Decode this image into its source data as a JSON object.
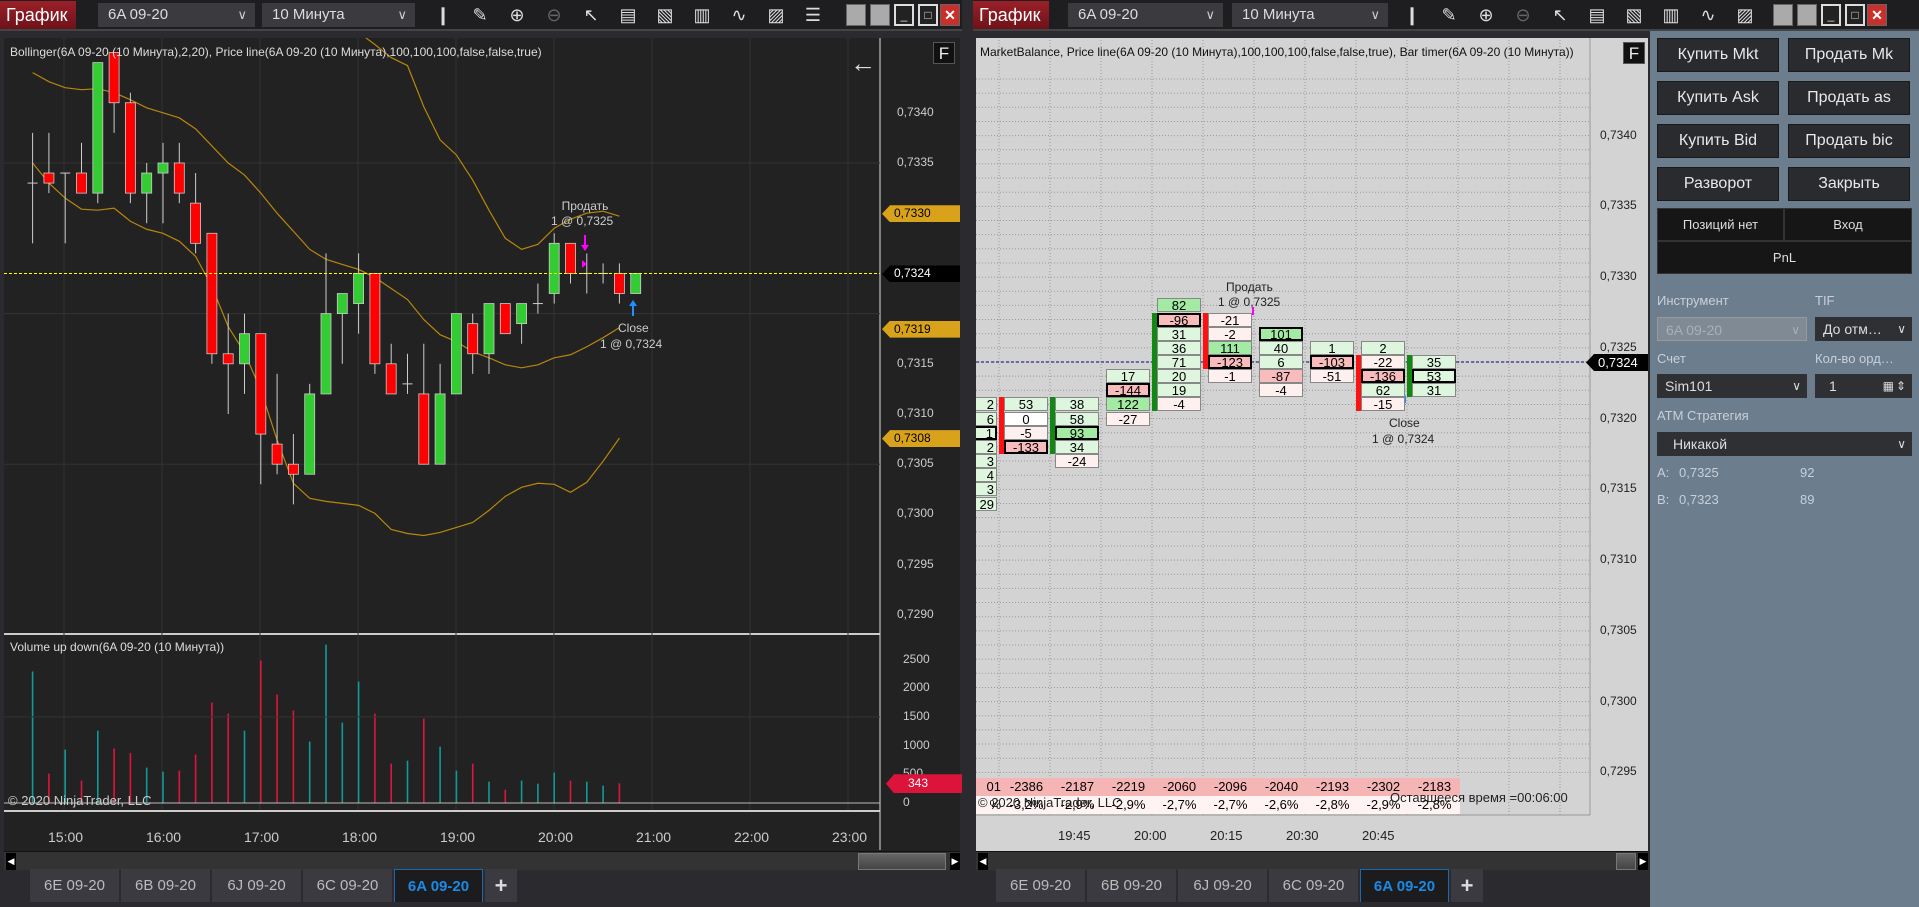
{
  "left_window": {
    "title": "График",
    "instrument": "6A 09-20",
    "interval": "10 Минута",
    "indicator_label": "Bollinger(6A 09-20 (10 Минута),2,20), Price line(6A 09-20 (10 Минута),100,100,100,false,false,true)",
    "volume_label": "Volume up down(6A 09-20 (10 Минута))",
    "copyright": "© 2020 NinjaTrader, LLC",
    "f_button": "F",
    "back_arrow": "←",
    "price_axis": [
      "0,7340",
      "0,7335",
      "0,7315",
      "0,7310",
      "0,7305",
      "0,7300",
      "0,7295",
      "0,7290"
    ],
    "price_axis_values": [
      0.734,
      0.7335,
      0.7315,
      0.731,
      0.7305,
      0.73,
      0.7295,
      0.729
    ],
    "tags": [
      {
        "text": "0,7330",
        "value": 0.733,
        "color": "#d9a21b",
        "fg": "#000"
      },
      {
        "text": "0,7324",
        "value": 0.7324,
        "color": "#000000",
        "fg": "#fff"
      },
      {
        "text": "0,7319",
        "value": 0.73185,
        "color": "#d9a21b",
        "fg": "#000"
      },
      {
        "text": "0,7308",
        "value": 0.73076,
        "color": "#d9a21b",
        "fg": "#000"
      }
    ],
    "volume_axis": [
      "2500",
      "2000",
      "1500",
      "1000",
      "500",
      "0"
    ],
    "volume_axis_values": [
      2500,
      2000,
      1500,
      1000,
      500,
      0
    ],
    "volume_tag": "343",
    "time_axis": [
      "15:00",
      "16:00",
      "17:00",
      "18:00",
      "19:00",
      "20:00",
      "21:00",
      "22:00",
      "23:00"
    ],
    "sell_marker": {
      "label": "Продать",
      "detail": "1 @ 0,7325"
    },
    "close_marker": {
      "label": "Close",
      "detail": "1 @ 0,7324"
    },
    "tabs": [
      "6E 09-20",
      "6B 09-20",
      "6J 09-20",
      "6C 09-20",
      "6A 09-20"
    ],
    "active_tab": 4,
    "plus": "+"
  },
  "right_window": {
    "title": "График",
    "instrument": "6A 09-20",
    "interval": "10 Минута",
    "indicator_label": "MarketBalance, Price line(6A 09-20 (10 Минута),100,100,100,false,false,true), Bar timer(6A 09-20 (10 Минута))",
    "f_button": "F",
    "copyright": "© 2020 NinjaTrader, LLC",
    "remaining_time": "Оставшееся время =00:06:00",
    "price_axis": [
      "0,7340",
      "0,7335",
      "0,7330",
      "0,7325",
      "0,7320",
      "0,7315",
      "0,7310",
      "0,7305",
      "0,7300",
      "0,7295"
    ],
    "price_axis_values": [
      0.734,
      0.7335,
      0.733,
      0.7325,
      0.732,
      0.7315,
      0.731,
      0.7305,
      0.73,
      0.7295
    ],
    "price_tag": "0,7324",
    "time_axis": [
      "19:45",
      "20:00",
      "20:15",
      "20:30",
      "20:45"
    ],
    "sell_marker": {
      "label": "Продать",
      "detail": "1 @ 0,7325"
    },
    "close_marker": {
      "label": "Close",
      "detail": "1 @ 0,7324"
    },
    "tabs": [
      "6E 09-20",
      "6B 09-20",
      "6J 09-20",
      "6C 09-20",
      "6A 09-20"
    ],
    "active_tab": 4,
    "plus": "+"
  },
  "toolbar_icons": [
    "candlestick-icon",
    "pencil-icon",
    "zoom-in-icon",
    "zoom-out-icon",
    "pointer-icon",
    "data-box-icon",
    "properties-icon",
    "bars-icon",
    "strategy-icon",
    "clipboard-icon",
    "list-icon"
  ],
  "order_panel": {
    "buttons": [
      "Купить Mkt",
      "Продать Mk",
      "Купить Ask",
      "Продать as",
      "Купить Bid",
      "Продать bic",
      "Разворот",
      "Закрыть"
    ],
    "position": "Позиций нет",
    "entry": "Вход",
    "pnl": "PnL",
    "instrument_label": "Инструмент",
    "instrument_value": "6A 09-20",
    "tif_label": "TIF",
    "tif_value": "До отм…",
    "account_label": "Счет",
    "account_value": "Sim101",
    "qty_label": "Кол-во орд…",
    "qty_value": "1",
    "atm_label": "АТМ Стратегия",
    "atm_value": "Никакой",
    "ask_label": "A:",
    "ask_price": "0,7325",
    "ask_size": "92",
    "bid_label": "B:",
    "bid_price": "0,7323",
    "bid_size": "89"
  },
  "colors": {
    "up": "#33cc33",
    "down": "#ff0000",
    "vol_up": "#0f9a9a",
    "vol_down": "#e0143c",
    "band": "#b8860b",
    "price_line": "#ffff00"
  },
  "chart_data": [
    {
      "type": "candlestick",
      "title": "6A 09-20 (10 Минута)",
      "start_time": "14:40",
      "interval_minutes": 10,
      "ohlc": [
        [
          0.7333,
          0.7338,
          0.7327,
          0.7333
        ],
        [
          0.7334,
          0.7338,
          0.7332,
          0.7333
        ],
        [
          0.7334,
          0.7334,
          0.7327,
          0.7334
        ],
        [
          0.7334,
          0.7337,
          0.7332,
          0.7332
        ],
        [
          0.7332,
          0.7345,
          0.7331,
          0.7345
        ],
        [
          0.7346,
          0.7346,
          0.7338,
          0.7341
        ],
        [
          0.7341,
          0.7342,
          0.7331,
          0.7332
        ],
        [
          0.7332,
          0.7335,
          0.7329,
          0.7334
        ],
        [
          0.7334,
          0.7337,
          0.7329,
          0.7335
        ],
        [
          0.7335,
          0.7337,
          0.7331,
          0.7332
        ],
        [
          0.7331,
          0.7334,
          0.7326,
          0.7327
        ],
        [
          0.7328,
          0.7328,
          0.7315,
          0.7316
        ],
        [
          0.7316,
          0.732,
          0.731,
          0.7315
        ],
        [
          0.7315,
          0.732,
          0.7312,
          0.7318
        ],
        [
          0.7318,
          0.7318,
          0.7303,
          0.7308
        ],
        [
          0.7307,
          0.7314,
          0.7304,
          0.7305
        ],
        [
          0.7305,
          0.7308,
          0.7301,
          0.7304
        ],
        [
          0.7304,
          0.7313,
          0.7304,
          0.7312
        ],
        [
          0.7312,
          0.7326,
          0.7312,
          0.732
        ],
        [
          0.732,
          0.7322,
          0.7315,
          0.7322
        ],
        [
          0.7321,
          0.7326,
          0.7318,
          0.7324
        ],
        [
          0.7324,
          0.7324,
          0.7314,
          0.7315
        ],
        [
          0.7315,
          0.7317,
          0.7312,
          0.7312
        ],
        [
          0.7313,
          0.7316,
          0.7312,
          0.7313
        ],
        [
          0.7312,
          0.7317,
          0.7305,
          0.7305
        ],
        [
          0.7305,
          0.7315,
          0.7305,
          0.7312
        ],
        [
          0.7312,
          0.732,
          0.7312,
          0.732
        ],
        [
          0.7319,
          0.732,
          0.7314,
          0.7316
        ],
        [
          0.7316,
          0.7321,
          0.7314,
          0.7321
        ],
        [
          0.7321,
          0.7321,
          0.7318,
          0.7318
        ],
        [
          0.7319,
          0.7321,
          0.7317,
          0.7321
        ],
        [
          0.7321,
          0.7323,
          0.732,
          0.7321
        ],
        [
          0.7322,
          0.7328,
          0.7321,
          0.7327
        ],
        [
          0.7327,
          0.7327,
          0.7323,
          0.7324
        ],
        [
          0.7324,
          0.7326,
          0.7322,
          0.7324
        ],
        [
          0.7324,
          0.7325,
          0.7323,
          0.7324
        ],
        [
          0.7324,
          0.7325,
          0.7321,
          0.7322
        ],
        [
          0.7322,
          0.7324,
          0.7322,
          0.7324
        ]
      ],
      "bollinger_upper": [
        null,
        null,
        null,
        null,
        null,
        null,
        null,
        null,
        null,
        null,
        null,
        null,
        null,
        null,
        null,
        null,
        null,
        0.7352,
        0.735,
        0.7349,
        0.7348,
        0.73468,
        0.73455,
        0.73447,
        0.73406,
        0.73373,
        0.73358,
        0.73333,
        0.73303,
        0.73275,
        0.73264,
        0.73269,
        0.73285,
        0.73294,
        0.733,
        0.73302,
        0.73297
      ],
      "bollinger_middle": [
        0.7344,
        0.73431,
        0.73425,
        0.73423,
        0.73424,
        0.7342,
        0.73413,
        0.73405,
        0.734,
        0.73395,
        0.73384,
        0.73367,
        0.7335,
        0.73338,
        0.7332,
        0.733,
        0.73282,
        0.73264,
        0.73254,
        0.73249,
        0.73244,
        0.73236,
        0.73225,
        0.73214,
        0.73194,
        0.73179,
        0.73172,
        0.73162,
        0.73156,
        0.73149,
        0.73146,
        0.73149,
        0.73156,
        0.73159,
        0.73167,
        0.73176,
        0.73186
      ],
      "bollinger_lower": [
        0.7335,
        0.7333,
        0.73315,
        0.73304,
        0.73303,
        0.73305,
        0.73292,
        0.73284,
        0.7328,
        0.73272,
        0.73257,
        0.73227,
        0.73187,
        0.73161,
        0.73124,
        0.73074,
        0.73031,
        0.73016,
        0.73013,
        0.73011,
        0.73009,
        0.73001,
        0.72985,
        0.72981,
        0.72979,
        0.72982,
        0.72987,
        0.72992,
        0.73004,
        0.73018,
        0.73027,
        0.73031,
        0.7303,
        0.73022,
        0.73032,
        0.73053,
        0.73076
      ],
      "price_line": 0.7324,
      "ylim": [
        0.7287,
        0.7347
      ]
    },
    {
      "type": "bar",
      "title": "Volume up down(6A 09-20 (10 Минута))",
      "values": [
        2290,
        512,
        930,
        390,
        1260,
        950,
        870,
        616,
        546,
        564,
        843,
        1750,
        1558,
        1260,
        2483,
        1890,
        1610,
        1070,
        2760,
        1400,
        2116,
        1558,
        686,
        738,
        1470,
        982,
        564,
        686,
        372,
        232,
        390,
        337,
        529,
        390,
        372,
        302,
        343
      ],
      "direction": [
        "up",
        "down",
        "up",
        "down",
        "up",
        "down",
        "down",
        "up",
        "up",
        "down",
        "down",
        "down",
        "down",
        "up",
        "down",
        "down",
        "down",
        "up",
        "up",
        "up",
        "up",
        "down",
        "down",
        "up",
        "down",
        "up",
        "up",
        "down",
        "up",
        "down",
        "up",
        "up",
        "up",
        "down",
        "up",
        "up",
        "down"
      ],
      "ylim": [
        0,
        2900
      ]
    },
    {
      "type": "table",
      "title": "MarketBalance footprint",
      "columns": [
        {
          "top": 0.7321,
          "values": [
            "2",
            "6",
            "1",
            "2",
            "3",
            "4",
            "3",
            "29"
          ],
          "boxed": 2,
          "bar": null
        },
        {
          "top": 0.7321,
          "values": [
            "53",
            "0",
            "-5",
            "-133"
          ],
          "boxed": 3,
          "bar": {
            "color": "down",
            "from": 0.7321,
            "to": 0.7318
          }
        },
        {
          "top": 0.7321,
          "values": [
            "38",
            "58",
            "93",
            "34",
            "-24"
          ],
          "boxed": 2,
          "bar": {
            "color": "up",
            "from": 0.7321,
            "to": 0.7318
          }
        },
        {
          "top": 0.7323,
          "values": [
            "17",
            "-144",
            "122",
            "-27"
          ],
          "boxed": 1,
          "bar": null
        },
        {
          "top": 0.7328,
          "values": [
            "82",
            "-96",
            "31",
            "36",
            "71",
            "20",
            "19",
            "-4"
          ],
          "boxed": 1,
          "bar": {
            "color": "up",
            "from": 0.7327,
            "to": 0.7321
          }
        },
        {
          "top": 0.7327,
          "values": [
            "-21",
            "-2",
            "111",
            "-123",
            "-1"
          ],
          "boxed": 3,
          "bar": {
            "color": "down",
            "from": 0.7327,
            "to": 0.7324
          }
        },
        {
          "top": 0.7326,
          "values": [
            "101",
            "40",
            "6",
            "-87",
            "-4"
          ],
          "boxed": 0,
          "bar": null
        },
        {
          "top": 0.7325,
          "values": [
            "1",
            "-103",
            "-51"
          ],
          "boxed": 1,
          "bar": null
        },
        {
          "top": 0.7325,
          "values": [
            "2",
            "-22",
            "-136",
            "62",
            "-15"
          ],
          "boxed": 2,
          "bar": {
            "color": "down",
            "from": 0.7324,
            "to": 0.7321
          }
        },
        {
          "top": 0.7324,
          "values": [
            "35",
            "53",
            "31"
          ],
          "boxed": 1,
          "bar": {
            "color": "up",
            "from": 0.7324,
            "to": 0.7322
          }
        }
      ],
      "delta_row": [
        "01",
        "-2386",
        "-2187",
        "-2219",
        "-2060",
        "-2096",
        "-2040",
        "-2193",
        "-2302",
        "-2183"
      ],
      "percent_row": [
        "%",
        "-3,2%",
        "-2,9%",
        "-2,9%",
        "-2,7%",
        "-2,7%",
        "-2,6%",
        "-2,8%",
        "-2,9%",
        "-2,8%"
      ]
    }
  ]
}
